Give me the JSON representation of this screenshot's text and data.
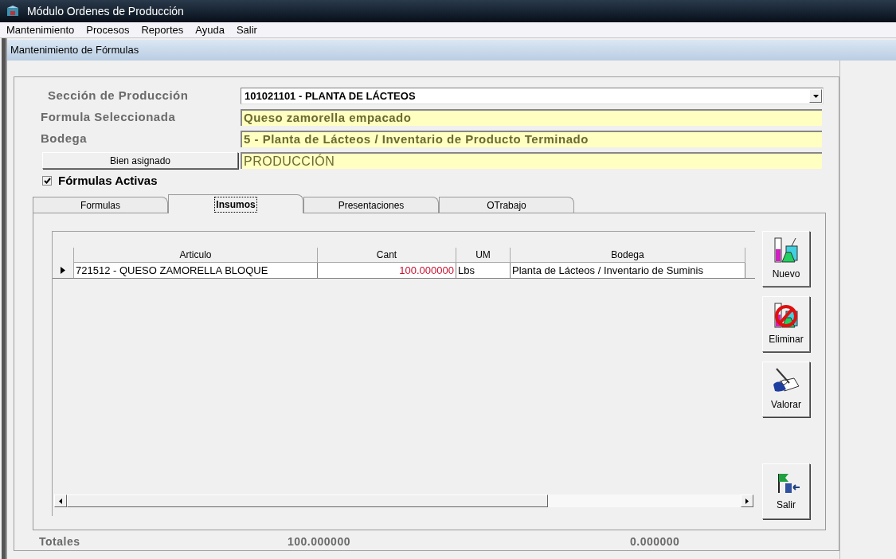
{
  "window": {
    "title": "Módulo Ordenes de Producción"
  },
  "menu": [
    "Mantenimiento",
    "Procesos",
    "Reportes",
    "Ayuda",
    "Salir"
  ],
  "child_window": {
    "title": "Mantenimiento de Fórmulas"
  },
  "fields": [
    {
      "kind": "combo",
      "label": "Sección de Producción",
      "value": "101021101 - PLANTA DE LÁCTEOS"
    },
    {
      "kind": "readonly",
      "label": "Formula Seleccionada",
      "value": "Queso zamorella empacado"
    },
    {
      "kind": "readonly",
      "label": "Bodega",
      "value": "5 - Planta de Lácteos / Inventario de Producto Terminado"
    },
    {
      "kind": "button",
      "label": "Bien asignado",
      "value": "PRODUCCIÓN"
    }
  ],
  "active_formulas": {
    "label": "Fórmulas Activas",
    "checked": true
  },
  "tabs": [
    {
      "label": "Formulas",
      "selected": false
    },
    {
      "label": "Insumos",
      "selected": true
    },
    {
      "label": "Presentaciones",
      "selected": false
    },
    {
      "label": "OTrabajo",
      "selected": false
    }
  ],
  "grid": {
    "columns": [
      "Articulo",
      "Cant",
      "UM",
      "Bodega"
    ],
    "rows": [
      {
        "selected": true,
        "cells": [
          "721512 - QUESO ZAMORELLA BLOQUE",
          "100.000000",
          "Lbs",
          "Planta de Lácteos / Inventario de Suminis"
        ]
      }
    ]
  },
  "buttons": [
    {
      "kind": "new",
      "label": "Nuevo"
    },
    {
      "kind": "delete",
      "label": "Eliminar"
    },
    {
      "kind": "value",
      "label": "Valorar"
    },
    {
      "kind": "exit",
      "label": "Salir"
    }
  ],
  "totals": {
    "label": "Totales",
    "quantity": "100.000000",
    "cost": "0.000000"
  }
}
